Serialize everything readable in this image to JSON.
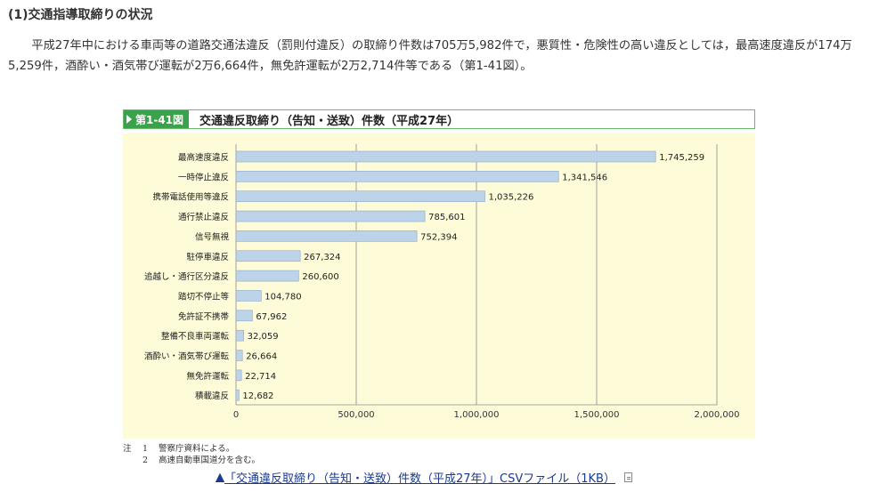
{
  "heading": "(1)交通指導取締りの状況",
  "paragraph": "平成27年中における車両等の道路交通法違反（罰則付違反）の取締り件数は705万5,982件で，悪質性・危険性の高い違反としては，最高速度違反が174万5,259件，酒酔い・酒気帯び運転が2万6,664件，無免許運転が2万2,714件等である（第1-41図）。",
  "figure": {
    "tag": "第1-41図",
    "title": "交通違反取締り（告知・送致）件数（平成27年）"
  },
  "chart_data": {
    "type": "bar",
    "orientation": "horizontal",
    "categories": [
      "最高速度違反",
      "一時停止違反",
      "携帯電話使用等違反",
      "通行禁止違反",
      "信号無視",
      "駐停車違反",
      "追越し・通行区分違反",
      "踏切不停止等",
      "免許証不携帯",
      "整備不良車両運転",
      "酒酔い・酒気帯び運転",
      "無免許運転",
      "積載違反"
    ],
    "values": [
      1745259,
      1341546,
      1035226,
      785601,
      752394,
      267324,
      260600,
      104780,
      67962,
      32059,
      26664,
      22714,
      12682
    ],
    "value_labels": [
      "1,745,259",
      "1,341,546",
      "1,035,226",
      "785,601",
      "752,394",
      "267,324",
      "260,600",
      "104,780",
      "67,962",
      "32,059",
      "26,664",
      "22,714",
      "12,682"
    ],
    "xlim": [
      0,
      2000000
    ],
    "x_ticks": [
      0,
      500000,
      1000000,
      1500000,
      2000000
    ],
    "x_tick_labels": [
      "0",
      "500,000",
      "1,000,000",
      "1,500,000",
      "2,000,000"
    ],
    "grid": "vertical",
    "bar_color": "#bcd3ea",
    "bar_stroke": "#8fa9c6",
    "panel_color": "#fdfbd8"
  },
  "notes": [
    {
      "mark": "注",
      "num": "1",
      "text": "警察庁資料による。"
    },
    {
      "mark": "",
      "num": "2",
      "text": "高速自動車国道分を含む。"
    }
  ],
  "csv_link": {
    "arrow": "▲",
    "text": "「交通違反取締り（告知・送致）件数（平成27年）」CSVファイル（1KB）"
  }
}
